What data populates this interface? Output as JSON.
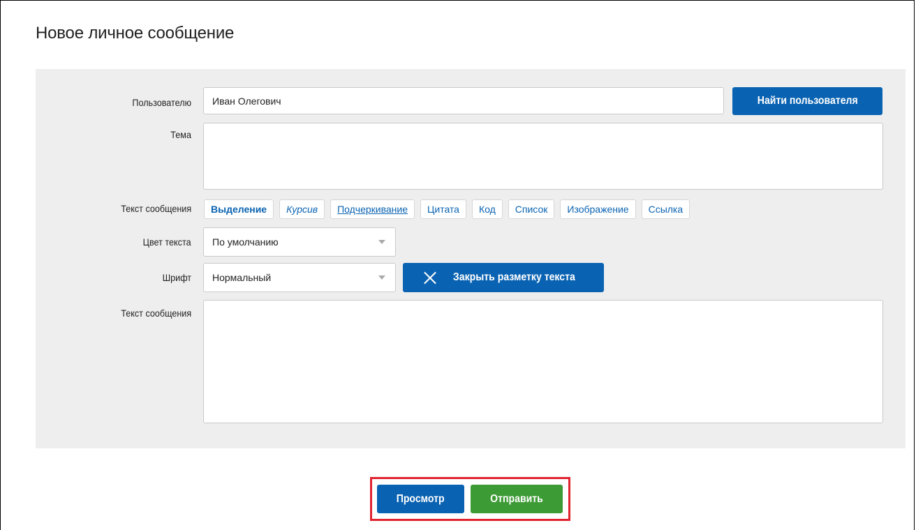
{
  "page": {
    "title": "Новое личное сообщение"
  },
  "form": {
    "recipient": {
      "label": "Пользователю",
      "value": "Иван Олегович",
      "find_button": "Найти пользователя"
    },
    "subject": {
      "label": "Тема",
      "value": ""
    },
    "markup": {
      "label": "Текст сообщения",
      "buttons": [
        {
          "label": "Выделение",
          "style": "bold"
        },
        {
          "label": "Курсив",
          "style": "italic"
        },
        {
          "label": "Подчеркивание",
          "style": "underline"
        },
        {
          "label": "Цитата",
          "style": "normal"
        },
        {
          "label": "Код",
          "style": "normal"
        },
        {
          "label": "Список",
          "style": "normal"
        },
        {
          "label": "Изображение",
          "style": "normal"
        },
        {
          "label": "Ссылка",
          "style": "normal"
        }
      ]
    },
    "text_color": {
      "label": "Цвет текста",
      "selected": "По умолчанию"
    },
    "font": {
      "label": "Шрифт",
      "selected": "Нормальный",
      "close_markup_button": "Закрыть разметку текста"
    },
    "message": {
      "label": "Текст сообщения",
      "value": ""
    }
  },
  "actions": {
    "preview": "Просмотр",
    "send": "Отправить"
  },
  "colors": {
    "primary": "#0a63b2",
    "send": "#3d9b35",
    "panel": "#eeeeee",
    "highlight": "#e0232f"
  }
}
